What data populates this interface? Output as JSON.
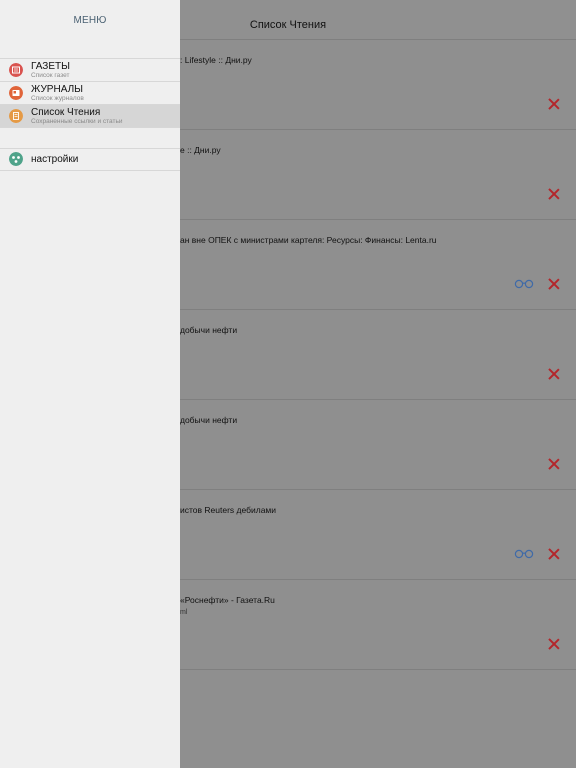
{
  "navbar": {
    "title": "Список Чтения"
  },
  "articles": [
    {
      "title": ": Lifestyle :: Дни.ру",
      "subtitle": "",
      "has_glasses": false
    },
    {
      "title": "e :: Дни.ру",
      "subtitle": "",
      "has_glasses": false
    },
    {
      "title": "ан вне ОПЕК с министрами картеля: Ресурсы: Финансы: Lenta.ru",
      "subtitle": "",
      "has_glasses": true
    },
    {
      "title": "добычи нефти",
      "subtitle": "",
      "has_glasses": false
    },
    {
      "title": "добычи нефти",
      "subtitle": "",
      "has_glasses": false
    },
    {
      "title": "истов Reuters дебилами",
      "subtitle": "",
      "has_glasses": true
    },
    {
      "title": "«Роснефти» - Газета.Ru",
      "subtitle": "ml",
      "has_glasses": false
    }
  ],
  "drawer": {
    "title": "МЕНЮ",
    "items": [
      {
        "label": "ГАЗЕТЫ",
        "sub": "Список газет",
        "icon": "newspaper-icon",
        "color": "#d9534f"
      },
      {
        "label": "ЖУРНАЛЫ",
        "sub": "Список журналов",
        "icon": "magazine-icon",
        "color": "#e0643a"
      },
      {
        "label": "Список Чтения",
        "sub": "Сохраненные ссылки и статьи",
        "icon": "reading-list-icon",
        "color": "#e59a45"
      }
    ],
    "settings": {
      "label": "настройки",
      "icon": "settings-icon",
      "color": "#4fa38a"
    }
  },
  "colors": {
    "delete": "#b3262b",
    "glasses": "#3f6aa8",
    "drawer_bg": "#efefef",
    "dim_bg": "#8f8f8f"
  }
}
